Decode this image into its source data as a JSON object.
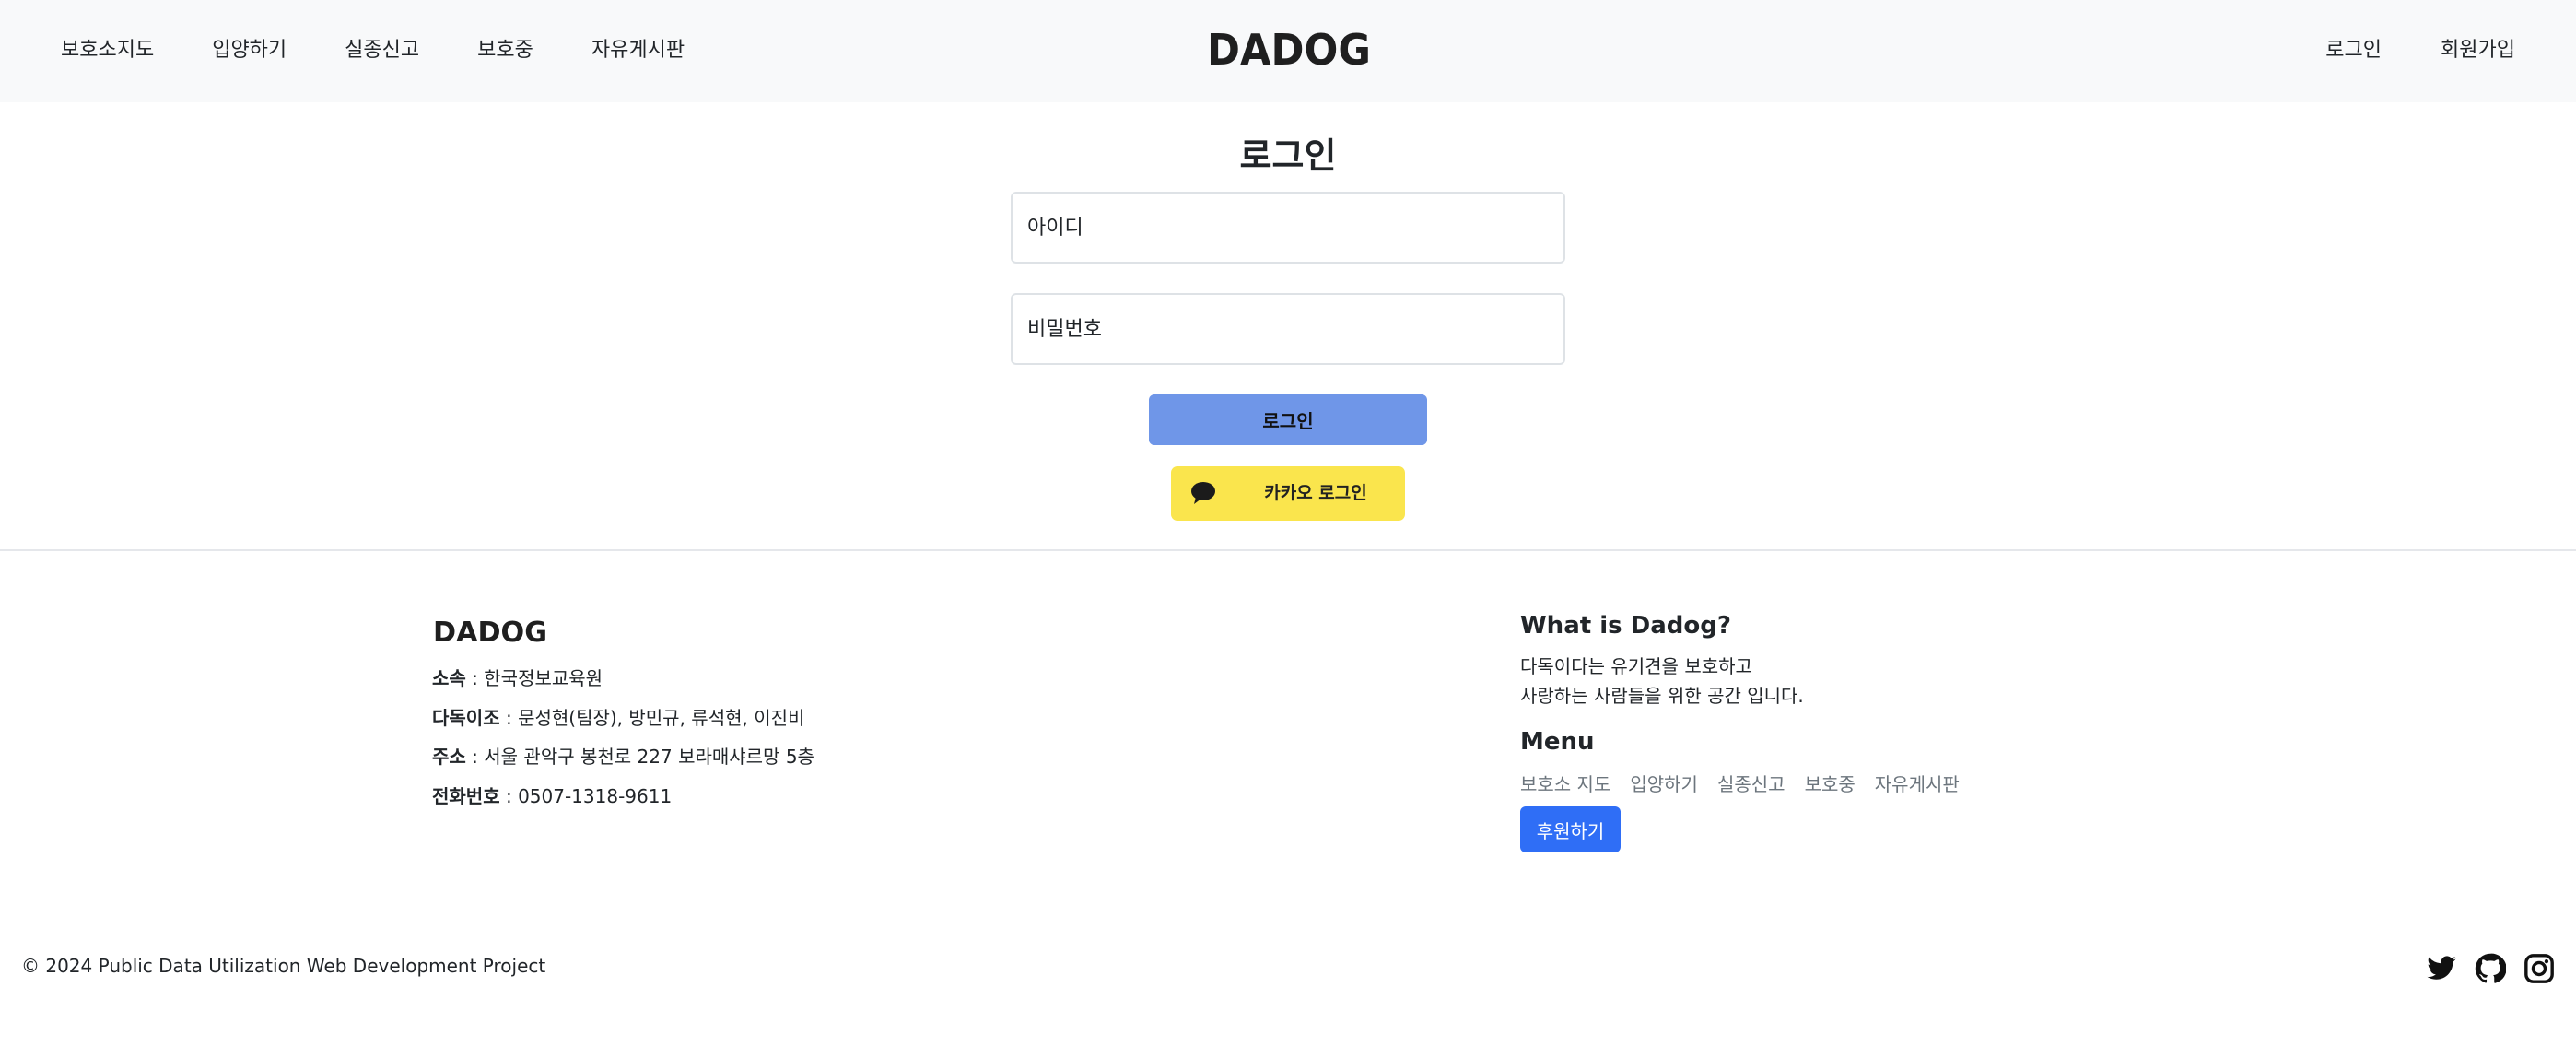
{
  "header": {
    "nav_left": [
      "보호소지도",
      "입양하기",
      "실종신고",
      "보호중",
      "자유게시판"
    ],
    "brand": "DADOG",
    "nav_right": [
      "로그인",
      "회원가입"
    ]
  },
  "login": {
    "title": "로그인",
    "id_placeholder": "아이디",
    "password_placeholder": "비밀번호",
    "login_button": "로그인",
    "kakao_button": "카카오 로그인"
  },
  "footer": {
    "brand": "DADOG",
    "info": [
      {
        "label": "소속",
        "value": " : 한국정보교육원"
      },
      {
        "label": "다독이조",
        "value": " : 문성현(팀장), 방민규, 류석현, 이진비"
      },
      {
        "label": "주소",
        "value": " : 서울 관악구 봉천로 227 보라매샤르망 5층"
      },
      {
        "label": "전화번호",
        "value": " : 0507-1318-9611"
      }
    ],
    "what_title": "What is Dadog?",
    "what_lines": [
      "다독이다는 유기견을 보호하고",
      "사랑하는 사람들을 위한 공간 입니다."
    ],
    "menu_title": "Menu",
    "menu_links": [
      "보호소 지도",
      "입양하기",
      "실종신고",
      "보호중",
      "자유게시판"
    ],
    "sponsor_button": "후원하기",
    "copyright": "© 2024 Public Data Utilization Web Development Project",
    "social_icons": [
      "twitter-icon",
      "github-icon",
      "instagram-icon"
    ]
  },
  "colors": {
    "header_bg": "#f8f9fa",
    "login_button": "#6f96e8",
    "kakao_button": "#fae54d",
    "sponsor_button": "#2f6ef6"
  }
}
